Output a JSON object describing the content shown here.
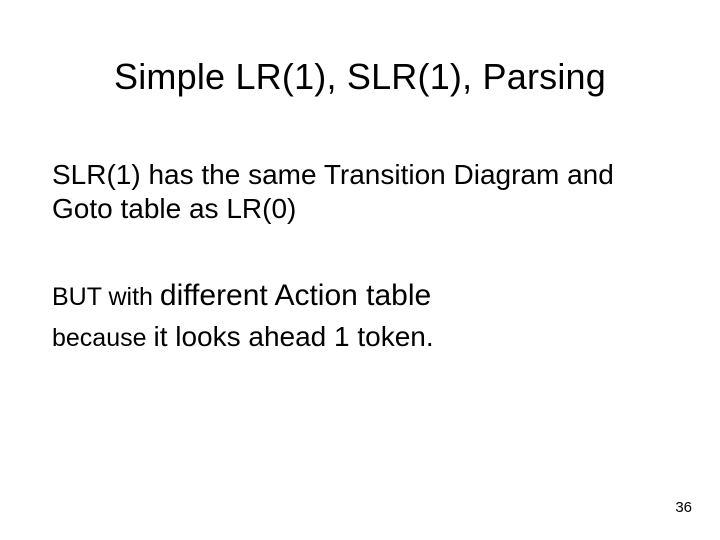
{
  "title": "Simple LR(1), SLR(1), Parsing",
  "para1": "SLR(1) has the same Transition Diagram and Goto table as LR(0)",
  "para2_prefix": "BUT with ",
  "para2_big": "different Action table",
  "para3_prefix": "because ",
  "para3_big": "it looks ahead 1 token.",
  "page_number": "36"
}
